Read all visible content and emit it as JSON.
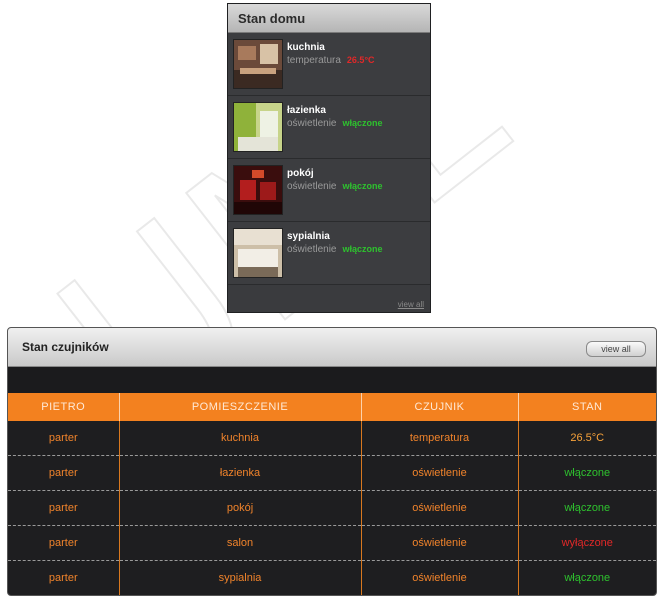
{
  "home": {
    "title": "Stan domu",
    "rooms": [
      {
        "name": "kuchnia",
        "sensor": "temperatura",
        "state": "26.5°C",
        "state_type": "off"
      },
      {
        "name": "łazienka",
        "sensor": "oświetlenie",
        "state": "włączone",
        "state_type": "on"
      },
      {
        "name": "pokój",
        "sensor": "oświetlenie",
        "state": "włączone",
        "state_type": "on"
      },
      {
        "name": "sypialnia",
        "sensor": "oświetlenie",
        "state": "włączone",
        "state_type": "on"
      }
    ],
    "footer_link": "view all"
  },
  "sensors": {
    "title": "Stan czujników",
    "view_all": "view all",
    "columns": [
      "PIETRO",
      "POMIESZCZENIE",
      "CZUJNIK",
      "STAN"
    ],
    "rows": [
      {
        "floor": "parter",
        "room": "kuchnia",
        "sensor": "temperatura",
        "state": "26.5°C",
        "state_type": "temp"
      },
      {
        "floor": "parter",
        "room": "łazienka",
        "sensor": "oświetlenie",
        "state": "włączone",
        "state_type": "on"
      },
      {
        "floor": "parter",
        "room": "pokój",
        "sensor": "oświetlenie",
        "state": "włączone",
        "state_type": "on"
      },
      {
        "floor": "parter",
        "room": "salon",
        "sensor": "oświetlenie",
        "state": "wyłączone",
        "state_type": "off"
      },
      {
        "floor": "parter",
        "room": "sypialnia",
        "sensor": "oświetlenie",
        "state": "włączone",
        "state_type": "on"
      }
    ]
  },
  "colors": {
    "accent_orange": "#f3811f",
    "state_on": "#2ec22e",
    "state_off": "#e12828",
    "state_temp": "#f7a23a"
  },
  "watermark": "UML"
}
